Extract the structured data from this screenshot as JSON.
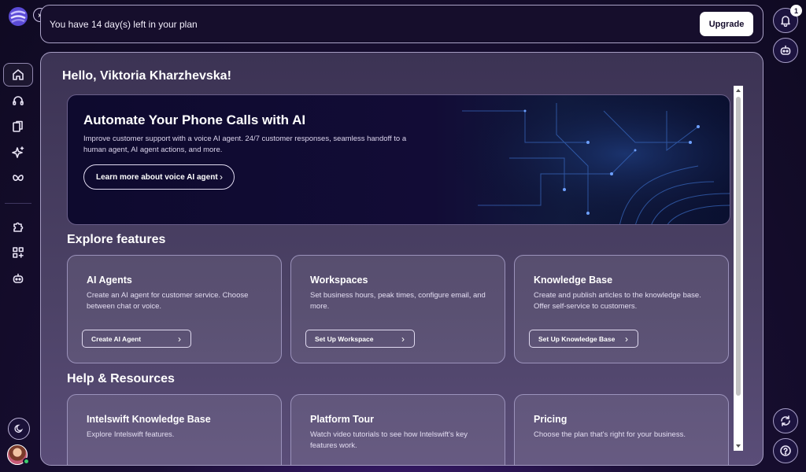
{
  "banner": {
    "text": "You have 14 day(s) left in your plan",
    "upgrade_label": "Upgrade"
  },
  "notifications": {
    "count": "1"
  },
  "main": {
    "greeting": "Hello, Viktoria Kharzhevska!",
    "hero": {
      "title": "Automate Your Phone Calls with AI",
      "description": "Improve customer support with a voice AI agent. 24/7 customer responses, seamless handoff to a human agent, AI agent actions, and more.",
      "button_label": "Learn more about voice AI agent"
    },
    "explore": {
      "title": "Explore features",
      "cards": [
        {
          "title": "AI Agents",
          "description": "Create an AI agent for customer service. Choose between chat or voice.",
          "button_label": "Create AI Agent"
        },
        {
          "title": "Workspaces",
          "description": "Set business hours, peak times, configure email, and more.",
          "button_label": "Set Up Workspace"
        },
        {
          "title": "Knowledge Base",
          "description": "Create and publish articles to the knowledge base. Offer self-service to customers.",
          "button_label": "Set Up Knowledge Base"
        }
      ]
    },
    "help": {
      "title": "Help & Resources",
      "cards": [
        {
          "title": "Intelswift Knowledge Base",
          "description": "Explore Intelswift features."
        },
        {
          "title": "Platform Tour",
          "description": "Watch video tutorials to see how Intelswift's key features work."
        },
        {
          "title": "Pricing",
          "description": "Choose the plan that's right for your business."
        }
      ]
    }
  },
  "icons": {
    "sidebar": [
      "home-icon",
      "headset-icon",
      "documents-icon",
      "sparkle-icon",
      "butterfly-icon",
      "puzzle-icon",
      "apps-add-icon",
      "bot-icon"
    ],
    "right": [
      "bell-icon",
      "bot-icon",
      "sync-icon",
      "help-icon"
    ]
  },
  "colors": {
    "background": "#150d2c",
    "accent": "#3a1a6e",
    "panel": "#453b5e"
  }
}
